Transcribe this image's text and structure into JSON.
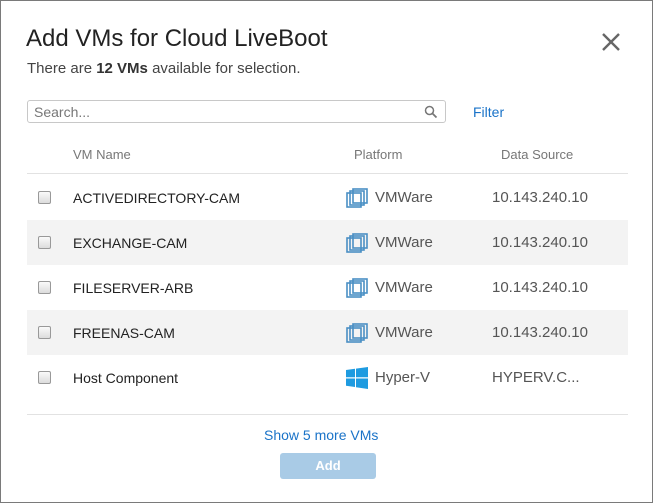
{
  "dialog": {
    "title": "Add VMs for Cloud LiveBoot",
    "subtitle_prefix": "There are ",
    "subtitle_count": "12 VMs",
    "subtitle_suffix": " available for selection.",
    "close_icon": "close-icon"
  },
  "search": {
    "placeholder": "Search...",
    "value": "",
    "icon": "search-icon",
    "filter_label": "Filter"
  },
  "table": {
    "columns": [
      "VM Name",
      "Platform",
      "Data Source"
    ],
    "rows": [
      {
        "name": "ACTIVEDIRECTORY-CAM",
        "platform": "VMWare",
        "platform_icon": "vmware-icon",
        "data_source": "10.143.240.10",
        "checked": false
      },
      {
        "name": "EXCHANGE-CAM",
        "platform": "VMWare",
        "platform_icon": "vmware-icon",
        "data_source": "10.143.240.10",
        "checked": false
      },
      {
        "name": "FILESERVER-ARB",
        "platform": "VMWare",
        "platform_icon": "vmware-icon",
        "data_source": "10.143.240.10",
        "checked": false
      },
      {
        "name": "FREENAS-CAM",
        "platform": "VMWare",
        "platform_icon": "vmware-icon",
        "data_source": "10.143.240.10",
        "checked": false
      },
      {
        "name": "Host Component",
        "platform": "Hyper-V",
        "platform_icon": "windows-icon",
        "data_source": "HYPERV.C...",
        "checked": false
      }
    ]
  },
  "footer": {
    "show_more_label": "Show 5 more VMs",
    "add_label": "Add"
  },
  "colors": {
    "link": "#1a73c8",
    "add_button_disabled": "#a9cbe6",
    "vmware_icon": "#4a8fc4",
    "windows_icon": "#1e9be0",
    "row_alt": "#f3f3f3"
  }
}
